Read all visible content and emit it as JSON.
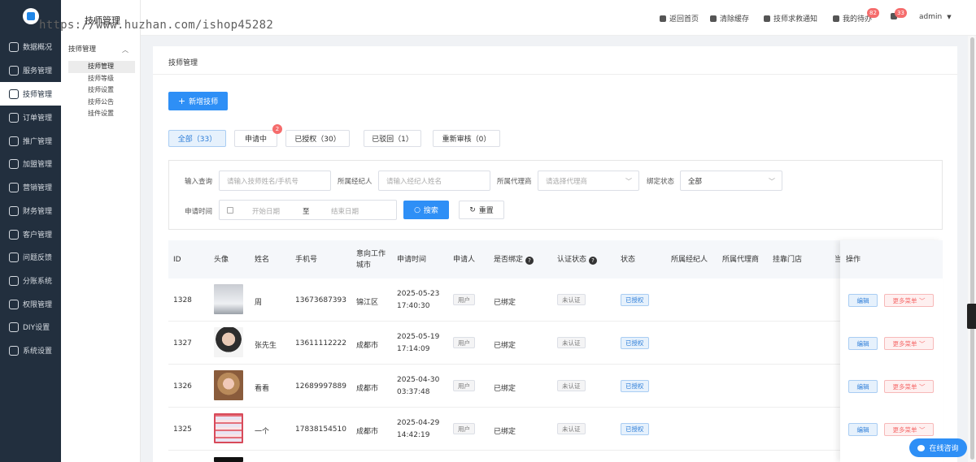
{
  "watermark": "https://www.huzhan.com/ishop45282",
  "sidebar": {
    "items": [
      {
        "label": "数据概况",
        "icon": "dashboard-icon"
      },
      {
        "label": "服务管理",
        "icon": "service-icon"
      },
      {
        "label": "技师管理",
        "icon": "technician-icon",
        "active": true
      },
      {
        "label": "订单管理",
        "icon": "order-icon"
      },
      {
        "label": "推广管理",
        "icon": "promotion-icon"
      },
      {
        "label": "加盟管理",
        "icon": "franchise-icon"
      },
      {
        "label": "营销管理",
        "icon": "marketing-icon"
      },
      {
        "label": "财务管理",
        "icon": "finance-icon"
      },
      {
        "label": "客户管理",
        "icon": "customer-icon"
      },
      {
        "label": "问题反馈",
        "icon": "feedback-icon"
      },
      {
        "label": "分账系统",
        "icon": "split-icon"
      },
      {
        "label": "权限管理",
        "icon": "permission-icon"
      },
      {
        "label": "DIY设置",
        "icon": "diy-icon"
      },
      {
        "label": "系统设置",
        "icon": "settings-icon"
      }
    ]
  },
  "submenu": {
    "title": "技师管理",
    "group": "技师管理",
    "items": [
      "技师管理",
      "技师等级",
      "技师设置",
      "技师公告",
      "挂件设置"
    ]
  },
  "topbar": {
    "home": "返回首页",
    "clear_cache": "清除缓存",
    "sos": "技师求救通知",
    "todo": "我的待办",
    "todo_count": "82",
    "notice_count": "33",
    "user": "admin"
  },
  "breadcrumb": "技师管理",
  "add_button": "新增技师",
  "tabs": [
    {
      "label": "全部（33）",
      "active": true
    },
    {
      "label": "申请中",
      "badge": "2"
    },
    {
      "label": "已授权（30）"
    },
    {
      "label": "已驳回（1）"
    },
    {
      "label": "重新审核（0）"
    }
  ],
  "filters": {
    "keyword_label": "输入查询",
    "keyword_placeholder": "请输入技师姓名/手机号",
    "agent_label": "所属经纪人",
    "agent_placeholder": "请输入经纪人姓名",
    "proxy_label": "所属代理商",
    "proxy_placeholder": "请选择代理商",
    "bind_label": "绑定状态",
    "bind_value": "全部",
    "time_label": "申请时间",
    "start_placeholder": "开始日期",
    "sep": "至",
    "end_placeholder": "结束日期",
    "search": "搜索",
    "reset": "重置"
  },
  "table": {
    "headers": {
      "id": "ID",
      "avatar": "头像",
      "name": "姓名",
      "phone": "手机号",
      "city_1": "意向工作",
      "city_2": "城市",
      "time": "申请时间",
      "applicant": "申请人",
      "bound": "是否绑定",
      "auth": "认证状态",
      "status": "状态",
      "agent": "所属经纪人",
      "proxy": "所属代理商",
      "store": "挂靠门店",
      "cut": "当",
      "ops": "操作"
    },
    "rows": [
      {
        "id": "1328",
        "name": "周",
        "phone": "13673687393",
        "city": "锦江区",
        "date": "2025-05-23",
        "time": "17:40:30",
        "applicant": "用户",
        "bound": "已绑定",
        "auth": "未认证",
        "status": "已授权",
        "edit": "编辑",
        "more": "更多菜单"
      },
      {
        "id": "1327",
        "name": "张先生",
        "phone": "13611112222",
        "city": "成都市",
        "date": "2025-05-19",
        "time": "17:14:09",
        "applicant": "用户",
        "bound": "已绑定",
        "auth": "未认证",
        "status": "已授权",
        "edit": "编辑",
        "more": "更多菜单"
      },
      {
        "id": "1326",
        "name": "看看",
        "phone": "12689997889",
        "city": "成都市",
        "date": "2025-04-30",
        "time": "03:37:48",
        "applicant": "用户",
        "bound": "已绑定",
        "auth": "未认证",
        "status": "已授权",
        "edit": "编辑",
        "more": "更多菜单"
      },
      {
        "id": "1325",
        "name": "一个",
        "phone": "17838154510",
        "city": "成都市",
        "date": "2025-04-29",
        "time": "14:42:19",
        "applicant": "用户",
        "bound": "已绑定",
        "auth": "未认证",
        "status": "已授权",
        "edit": "编辑",
        "more": "更多菜单"
      }
    ]
  },
  "consult": "在线咨询",
  "colors": {
    "sidebar": "#222f3e",
    "primary": "#2e8ff6",
    "badge": "#f56c6c"
  }
}
